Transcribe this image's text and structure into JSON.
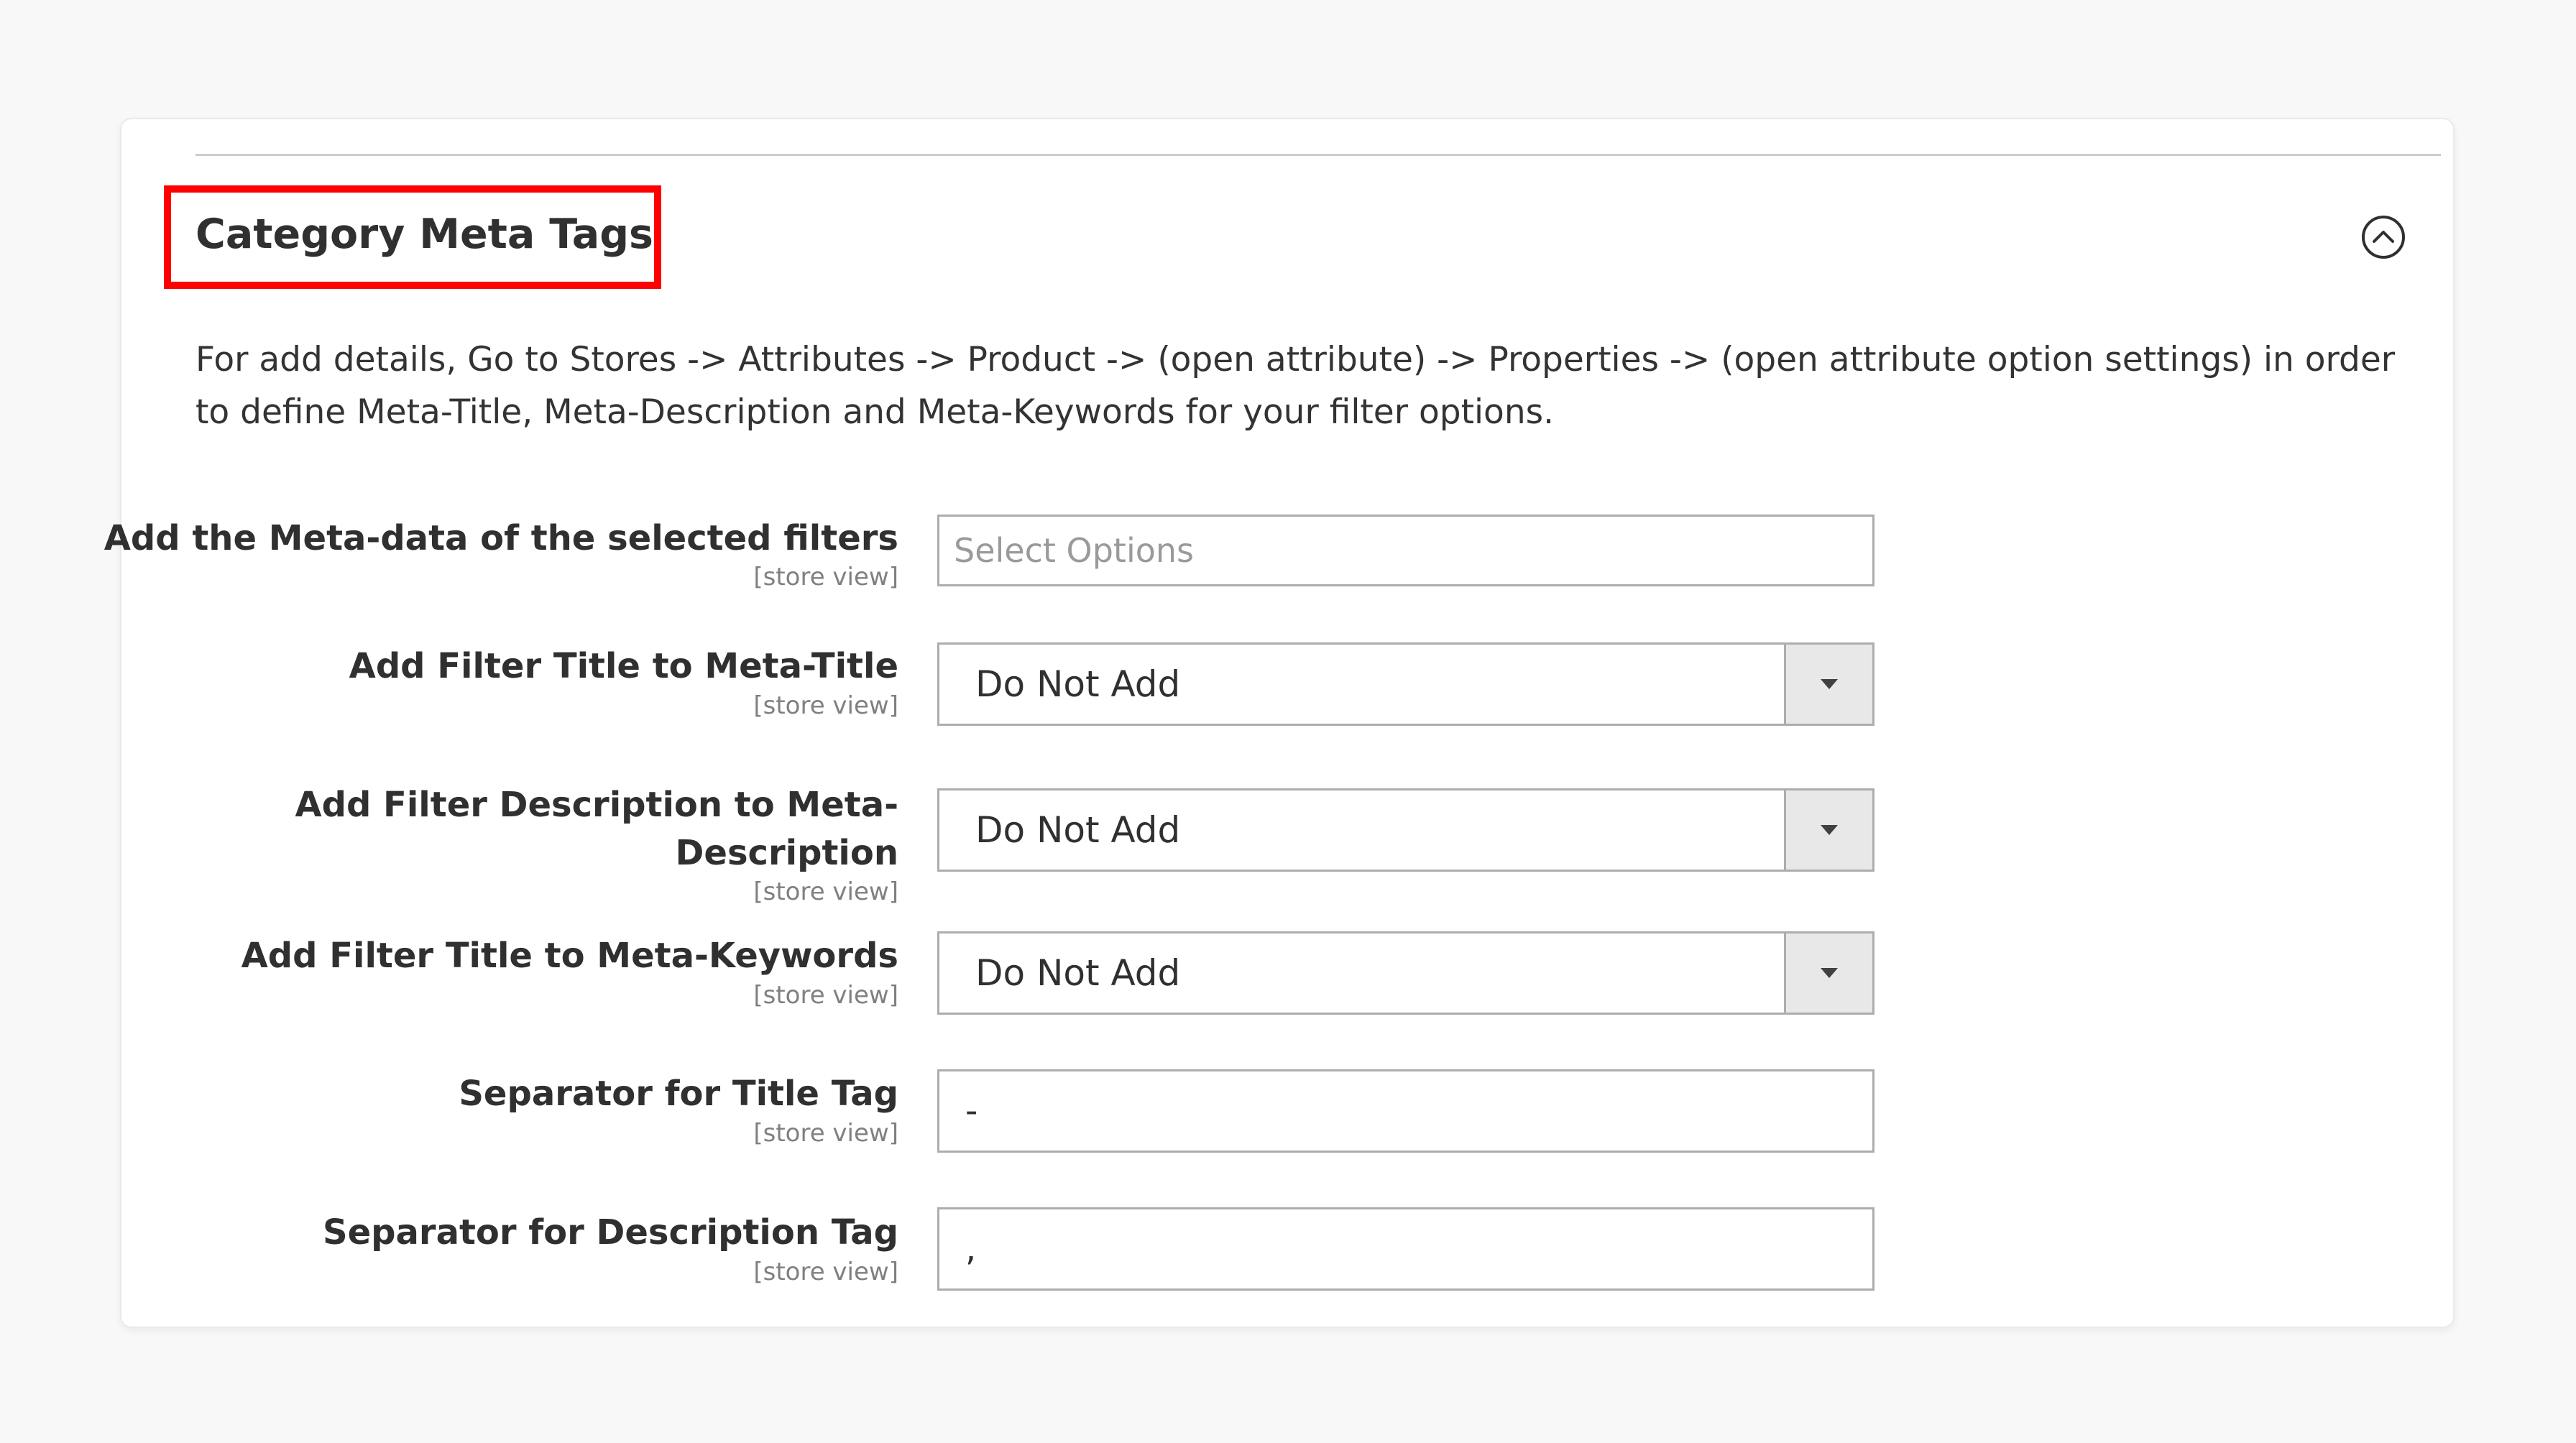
{
  "section": {
    "title": "Category Meta Tags",
    "description": "For add details, Go to Stores -> Attributes -> Product -> (open attribute) -> Properties -> (open attribute option settings) in order to define Meta-Title, Meta-Description and Meta-Keywords for your filter options.",
    "toggle_icon": "chevron-up-circle-icon"
  },
  "fields": {
    "meta_filters": {
      "label": "Add the Meta-data of the selected filters",
      "scope": "[store view]",
      "placeholder": "Select Options"
    },
    "meta_title": {
      "label": "Add Filter Title to Meta-Title",
      "scope": "[store view]",
      "value": "Do Not Add"
    },
    "meta_description": {
      "label_line1": "Add Filter Description to Meta-",
      "label_line2": "Description",
      "scope": "[store view]",
      "value": "Do Not Add"
    },
    "meta_keywords": {
      "label": "Add Filter Title to Meta-Keywords",
      "scope": "[store view]",
      "value": "Do Not Add"
    },
    "title_separator": {
      "label": "Separator for Title Tag",
      "scope": "[store view]",
      "value": "-"
    },
    "description_separator": {
      "label": "Separator for Description Tag",
      "scope": "[store view]",
      "value": ","
    }
  },
  "colors": {
    "highlight": "#ff0000",
    "card_bg": "#ffffff",
    "page_bg": "#f8f8f8"
  }
}
